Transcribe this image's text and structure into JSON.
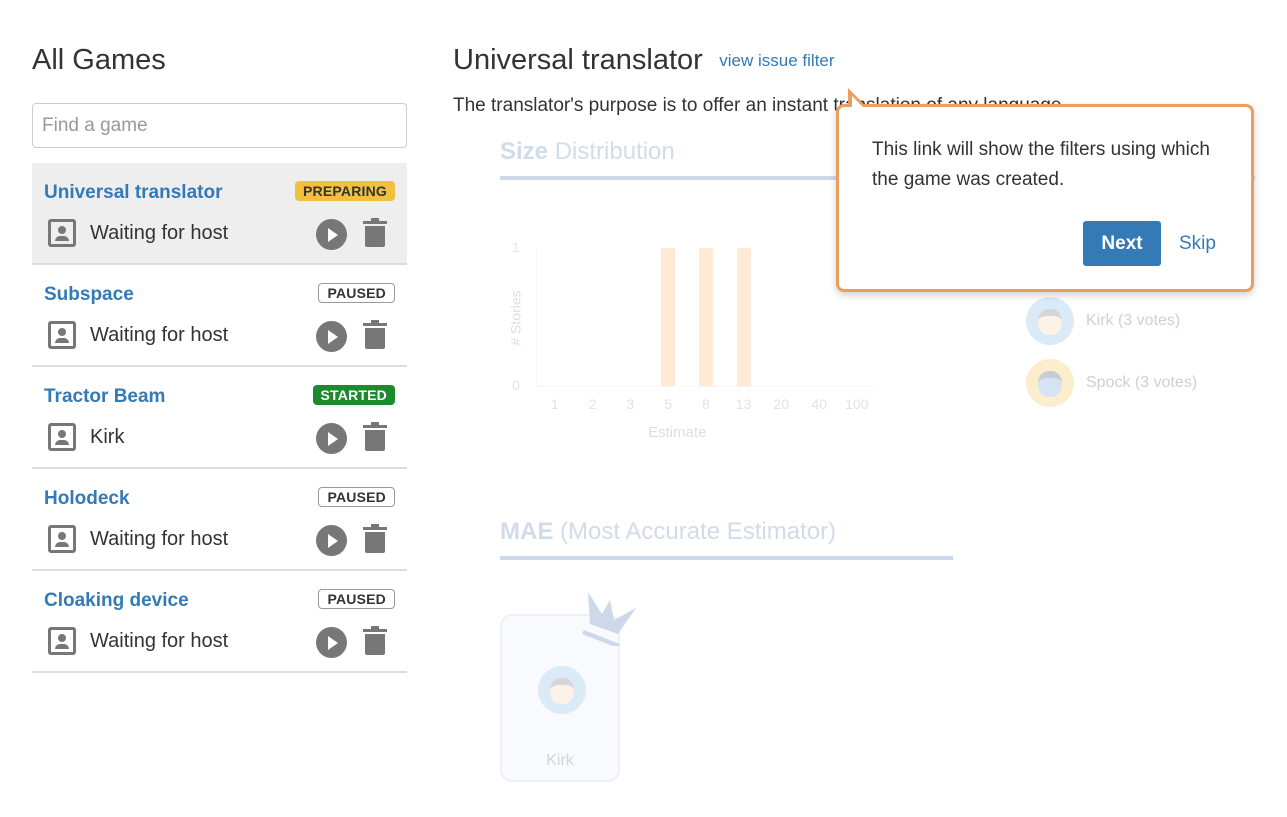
{
  "sidebar": {
    "title": "All Games",
    "search_placeholder": "Find a game",
    "search_value": "",
    "games": [
      {
        "name": "Universal translator",
        "status": "PREPARING",
        "status_kind": "preparing",
        "host": "Waiting for host",
        "active": true
      },
      {
        "name": "Subspace",
        "status": "PAUSED",
        "status_kind": "paused",
        "host": "Waiting for host",
        "active": false
      },
      {
        "name": "Tractor Beam",
        "status": "STARTED",
        "status_kind": "started",
        "host": "Kirk",
        "active": false
      },
      {
        "name": "Holodeck",
        "status": "PAUSED",
        "status_kind": "paused",
        "host": "Waiting for host",
        "active": false
      },
      {
        "name": "Cloaking device",
        "status": "PAUSED",
        "status_kind": "paused",
        "host": "Waiting for host",
        "active": false
      }
    ]
  },
  "main": {
    "title": "Universal translator",
    "issue_filter_link": "view issue filter",
    "description": "The translator's purpose is to offer an instant translation of any language.",
    "size_section": {
      "bold": "Size",
      "rest": "Distribution"
    },
    "mae_section": {
      "bold": "MAE",
      "rest": "(Most Accurate Estimator)"
    },
    "voters": [
      {
        "name": "Kirk",
        "label": "Kirk (3 votes)",
        "avatar": "kirk"
      },
      {
        "name": "Spock",
        "label": "Spock (3 votes)",
        "avatar": "spock"
      }
    ],
    "mae_winner": {
      "name": "Kirk",
      "avatar": "kirk"
    }
  },
  "chart_data": {
    "type": "bar",
    "title": "Size Distribution",
    "categories": [
      "1",
      "2",
      "3",
      "5",
      "8",
      "13",
      "20",
      "40",
      "100"
    ],
    "values": [
      0,
      0,
      0,
      1,
      1,
      1,
      0,
      0,
      0
    ],
    "xlabel": "Estimate",
    "ylabel": "# Stories",
    "ylim": [
      0,
      1
    ],
    "yticks": [
      "0",
      "1"
    ],
    "bar_color": "#f9b46a"
  },
  "tooltip": {
    "message": "This link will show the filters using which the game was created.",
    "next_label": "Next",
    "skip_label": "Skip"
  }
}
